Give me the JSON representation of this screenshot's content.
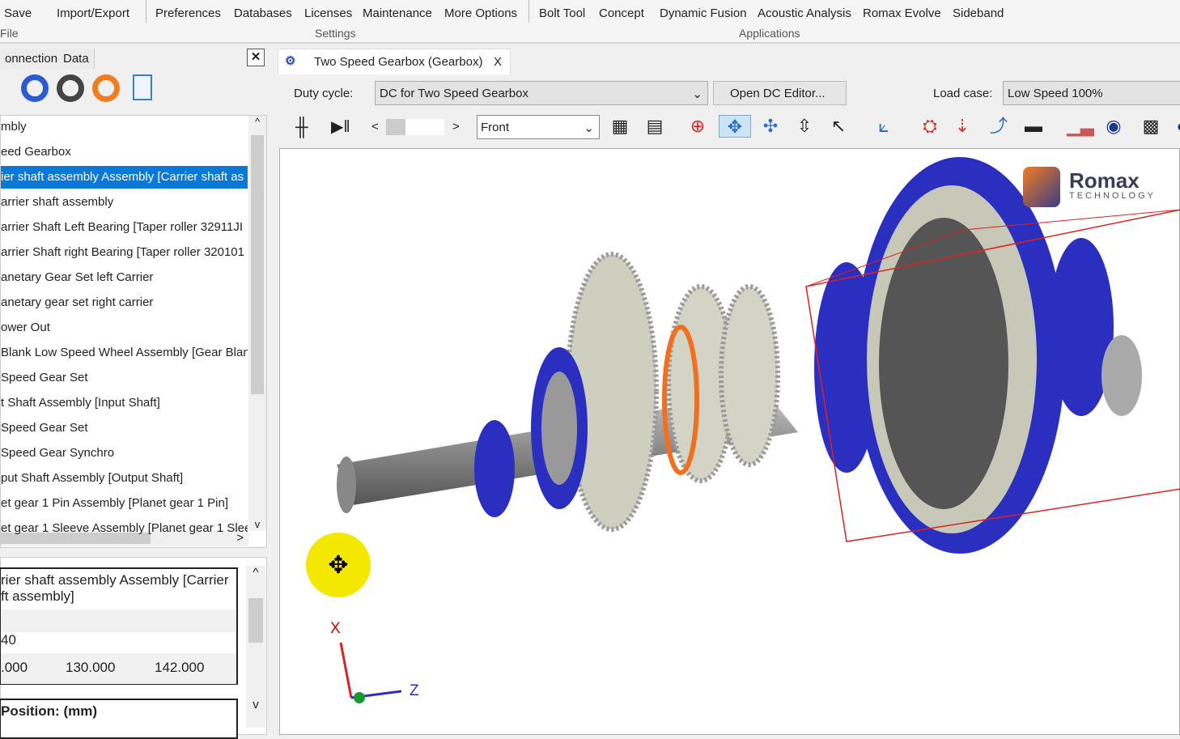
{
  "ribbon": {
    "file_items": [
      "Save",
      "Import/Export"
    ],
    "file_group": "File",
    "settings_items": [
      "Preferences",
      "Databases",
      "Licenses",
      "Maintenance",
      "More Options"
    ],
    "settings_group": "Settings",
    "app_items": [
      "Bolt Tool",
      "Concept",
      "Dynamic Fusion",
      "Acoustic Analysis",
      "Romax Evolve",
      "Sideband"
    ],
    "app_group": "Applications"
  },
  "left_panel": {
    "tabs": [
      "onnection",
      "Data"
    ],
    "close": "✕",
    "tree": [
      "mbly",
      "eed Gearbox",
      "ier shaft assembly Assembly [Carrier shaft as",
      "arrier shaft assembly",
      "arrier Shaft Left Bearing [Taper roller 32911JI",
      "arrier Shaft right Bearing [Taper roller 320101",
      "anetary Gear Set left Carrier",
      "anetary gear set right carrier",
      "ower Out",
      "Blank Low Speed Wheel Assembly [Gear Blan",
      "Speed Gear Set",
      "t Shaft Assembly [Input Shaft]",
      "Speed Gear Set",
      "Speed Gear Synchro",
      "put Shaft Assembly [Output Shaft]",
      "et gear 1 Pin Assembly [Planet gear 1 Pin]",
      "et gear 1 Sleeve Assembly [Planet gear 1 Slee"
    ],
    "selected_index": 2,
    "properties": {
      "title_line1": "rier shaft assembly Assembly [Carrier",
      "title_line2": "ft assembly]",
      "value_row": "40",
      "values": [
        ".000",
        "130.000",
        "142.000"
      ],
      "position_label": "Position: (mm)"
    }
  },
  "document": {
    "tab_title": "Two Speed Gearbox (Gearbox)",
    "tab_close": "X",
    "duty_cycle_label": "Duty cycle:",
    "duty_cycle_value": "DC for Two Speed Gearbox",
    "open_dc_editor": "Open DC Editor...",
    "load_case_label": "Load case:",
    "load_case_value": "Low Speed 100%",
    "view_value": "Front",
    "logo_text": "Romax",
    "logo_sub": "TECHNOLOGY",
    "axes": {
      "x": "X",
      "z": "Z"
    }
  },
  "colors": {
    "selection": "#0a78d7",
    "gear_blue": "#2b2fc0",
    "bbox_red": "#e02020",
    "cursor_yellow": "#f5e800"
  }
}
